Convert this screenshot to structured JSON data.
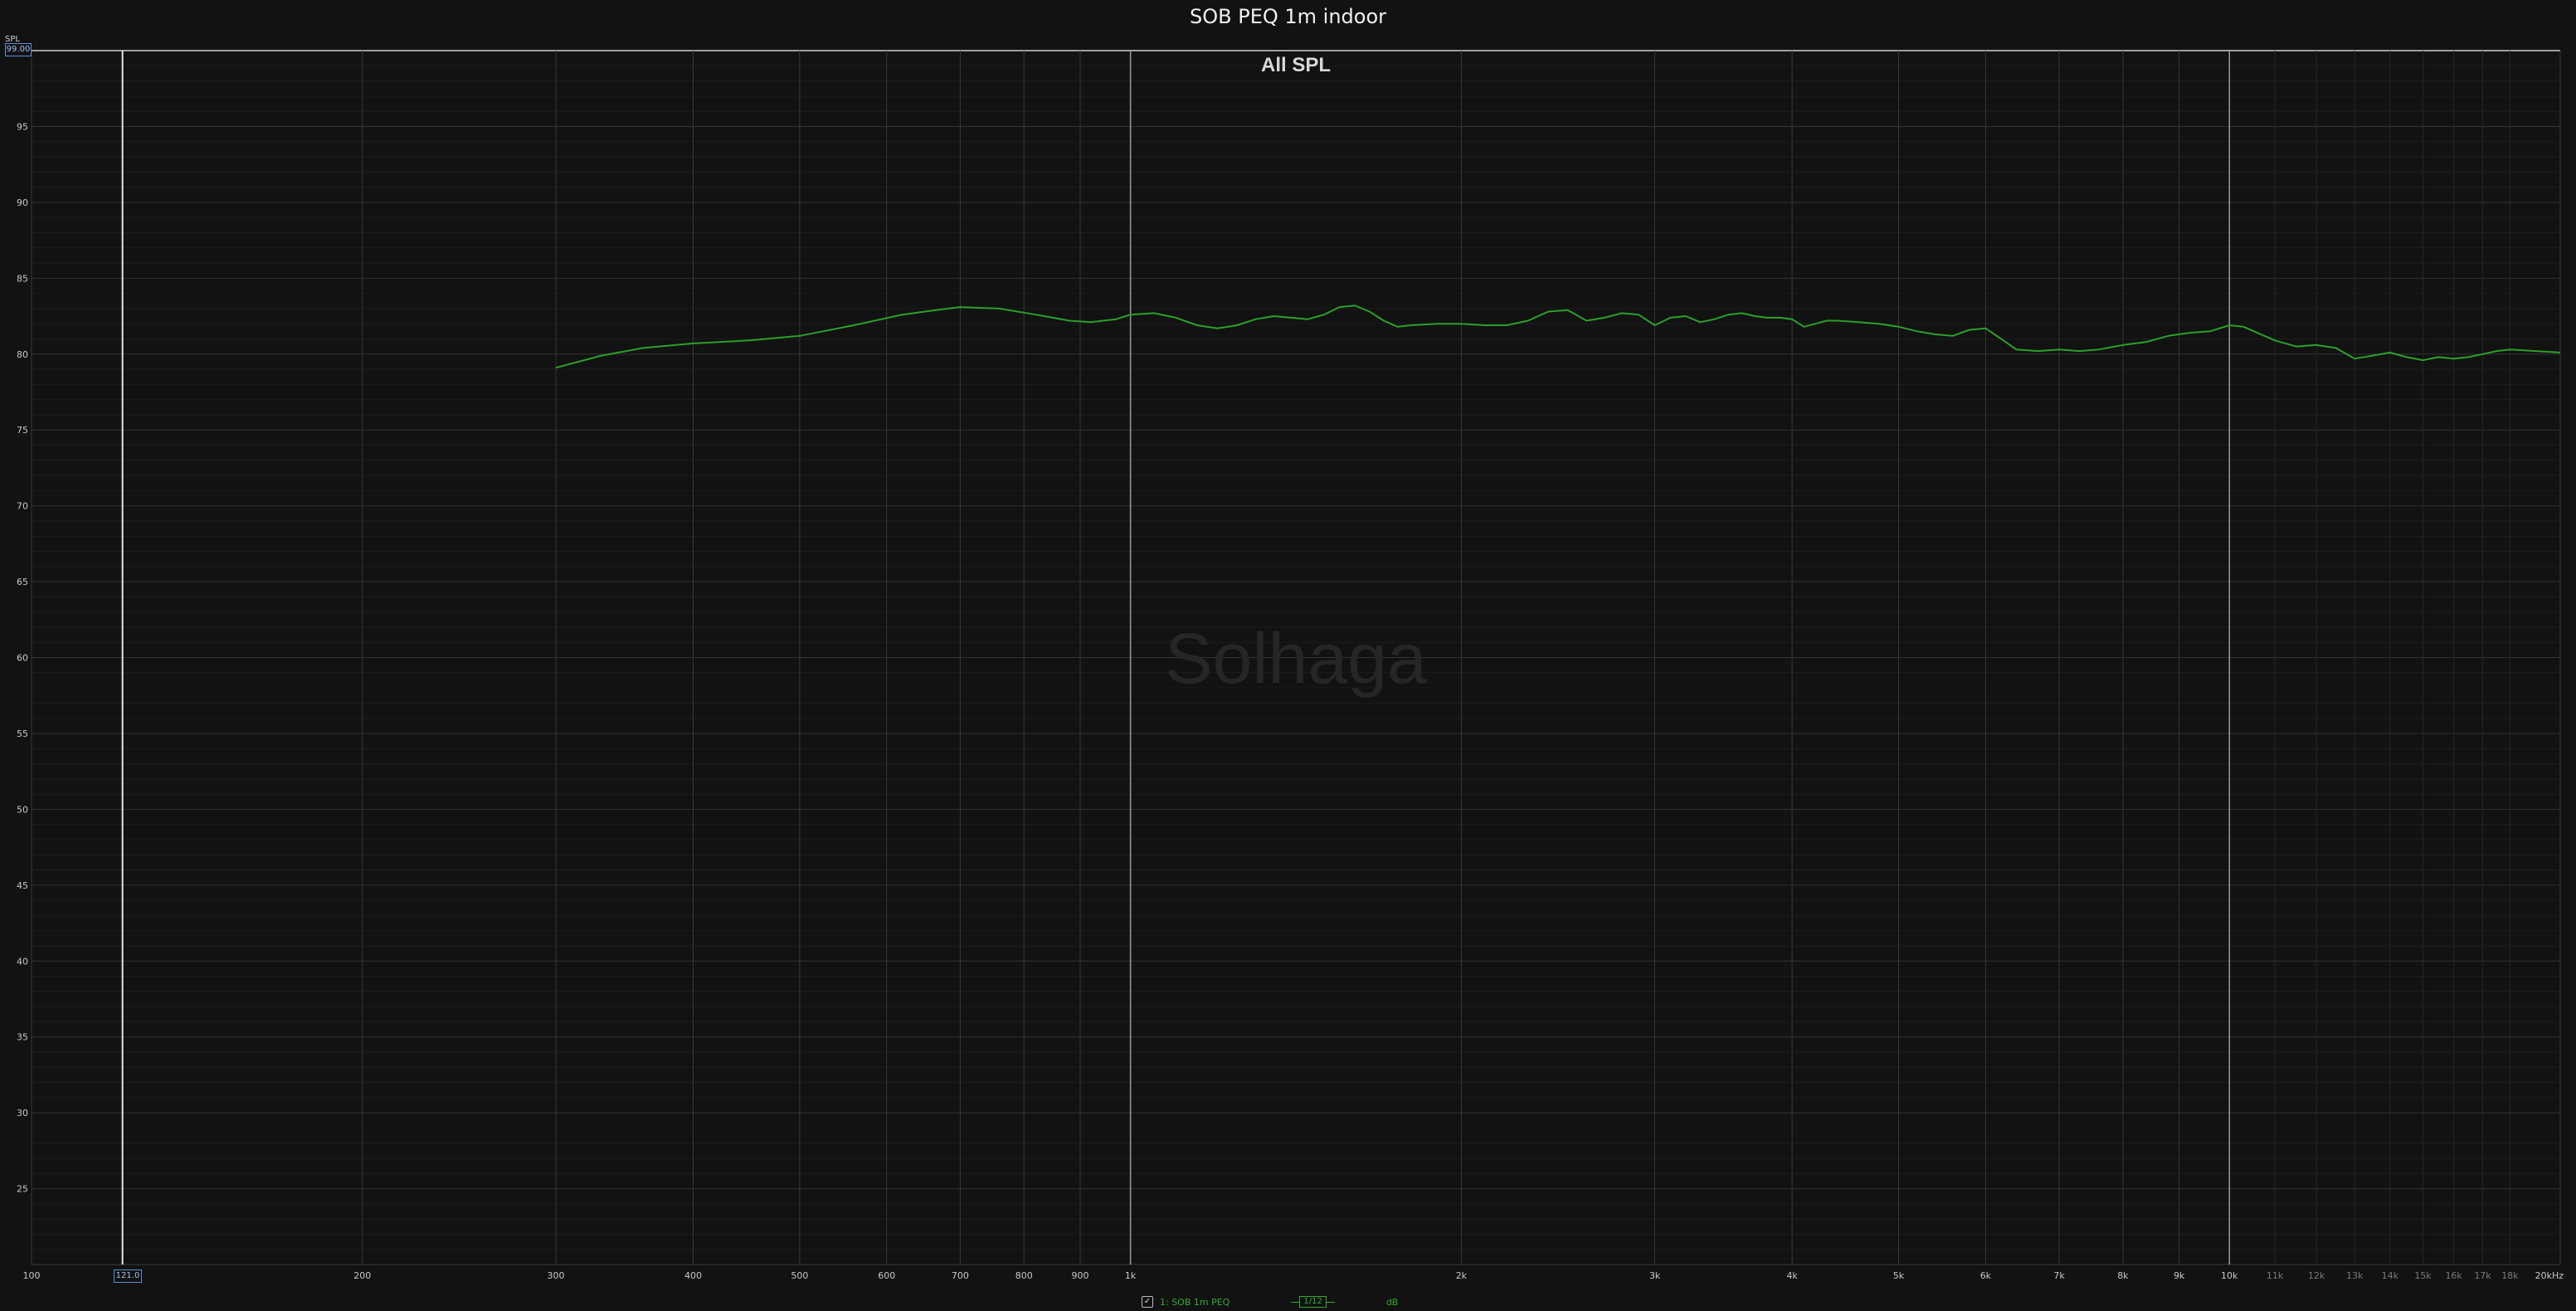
{
  "window": {
    "title": "SOB PEQ 1m indoor"
  },
  "chart_data": {
    "type": "line",
    "title": "SOB PEQ 1m indoor",
    "subtitle": "All SPL",
    "watermark": "Solhaga",
    "x_scale": "log",
    "xlim": [
      100,
      20000
    ],
    "ylim": [
      20,
      100
    ],
    "y_unit_label": "SPL",
    "y_readout": "99.00",
    "x_readout": "121.0",
    "x_ticks": [
      {
        "v": 100,
        "label": "100",
        "major": true
      },
      {
        "v": 200,
        "label": "200",
        "major": true
      },
      {
        "v": 300,
        "label": "300",
        "major": true
      },
      {
        "v": 400,
        "label": "400",
        "major": true
      },
      {
        "v": 500,
        "label": "500",
        "major": true
      },
      {
        "v": 600,
        "label": "600",
        "major": true
      },
      {
        "v": 700,
        "label": "700",
        "major": true
      },
      {
        "v": 800,
        "label": "800",
        "major": true
      },
      {
        "v": 900,
        "label": "900",
        "major": true
      },
      {
        "v": 1000,
        "label": "1k",
        "major": true
      },
      {
        "v": 2000,
        "label": "2k",
        "major": true
      },
      {
        "v": 3000,
        "label": "3k",
        "major": true
      },
      {
        "v": 4000,
        "label": "4k",
        "major": true
      },
      {
        "v": 5000,
        "label": "5k",
        "major": true
      },
      {
        "v": 6000,
        "label": "6k",
        "major": true
      },
      {
        "v": 7000,
        "label": "7k",
        "major": true
      },
      {
        "v": 8000,
        "label": "8k",
        "major": true
      },
      {
        "v": 9000,
        "label": "9k",
        "major": true
      },
      {
        "v": 10000,
        "label": "10k",
        "major": true
      },
      {
        "v": 11000,
        "label": "11k",
        "major": false
      },
      {
        "v": 12000,
        "label": "12k",
        "major": false
      },
      {
        "v": 13000,
        "label": "13k",
        "major": false
      },
      {
        "v": 14000,
        "label": "14k",
        "major": false
      },
      {
        "v": 15000,
        "label": "15k",
        "major": false
      },
      {
        "v": 16000,
        "label": "16k",
        "major": false
      },
      {
        "v": 17000,
        "label": "17k",
        "major": false
      },
      {
        "v": 18000,
        "label": "18k",
        "major": false
      },
      {
        "v": 20000,
        "label": "20kHz",
        "major": true
      }
    ],
    "y_ticks": [
      {
        "v": 95,
        "label": "95"
      },
      {
        "v": 90,
        "label": "90"
      },
      {
        "v": 85,
        "label": "85"
      },
      {
        "v": 80,
        "label": "80"
      },
      {
        "v": 75,
        "label": "75"
      },
      {
        "v": 70,
        "label": "70"
      },
      {
        "v": 65,
        "label": "65"
      },
      {
        "v": 60,
        "label": "60"
      },
      {
        "v": 55,
        "label": "55"
      },
      {
        "v": 50,
        "label": "50"
      },
      {
        "v": 45,
        "label": "45"
      },
      {
        "v": 40,
        "label": "40"
      },
      {
        "v": 35,
        "label": "35"
      },
      {
        "v": 30,
        "label": "30"
      },
      {
        "v": 25,
        "label": "25"
      }
    ],
    "cursor_lines_x": [
      121,
      1000,
      10000
    ],
    "series": [
      {
        "name": "1: SOB 1m PEQ",
        "color": "#2aa02a",
        "smoothing": "1/12",
        "unit": "dB",
        "x": [
          300,
          330,
          360,
          400,
          450,
          500,
          560,
          620,
          650,
          700,
          760,
          820,
          880,
          920,
          970,
          1000,
          1050,
          1100,
          1150,
          1200,
          1250,
          1300,
          1350,
          1400,
          1450,
          1500,
          1550,
          1600,
          1650,
          1700,
          1750,
          1800,
          1900,
          2000,
          2100,
          2200,
          2300,
          2400,
          2500,
          2600,
          2700,
          2800,
          2900,
          3000,
          3100,
          3200,
          3300,
          3400,
          3500,
          3600,
          3700,
          3800,
          3900,
          4000,
          4100,
          4200,
          4300,
          4400,
          4600,
          4800,
          5000,
          5200,
          5400,
          5600,
          5800,
          6000,
          6200,
          6400,
          6700,
          7000,
          7300,
          7600,
          8000,
          8400,
          8800,
          9200,
          9600,
          10000,
          10300,
          10600,
          11000,
          11500,
          12000,
          12500,
          13000,
          13500,
          14000,
          14500,
          15000,
          15500,
          16000,
          16500,
          17000,
          17500,
          18000,
          19000,
          20000
        ],
        "y": [
          79.1,
          79.9,
          80.4,
          80.7,
          80.9,
          81.2,
          81.9,
          82.6,
          82.8,
          83.1,
          83.0,
          82.6,
          82.2,
          82.1,
          82.3,
          82.6,
          82.7,
          82.4,
          81.9,
          81.7,
          81.9,
          82.3,
          82.5,
          82.4,
          82.3,
          82.6,
          83.1,
          83.2,
          82.8,
          82.2,
          81.8,
          81.9,
          82.0,
          82.0,
          81.9,
          81.9,
          82.2,
          82.8,
          82.9,
          82.2,
          82.4,
          82.7,
          82.6,
          81.9,
          82.4,
          82.5,
          82.1,
          82.3,
          82.6,
          82.7,
          82.5,
          82.4,
          82.4,
          82.3,
          81.8,
          82.0,
          82.2,
          82.2,
          82.1,
          82.0,
          81.8,
          81.5,
          81.3,
          81.2,
          81.6,
          81.7,
          81.0,
          80.3,
          80.2,
          80.3,
          80.2,
          80.3,
          80.6,
          80.8,
          81.2,
          81.4,
          81.5,
          81.9,
          81.8,
          81.4,
          80.9,
          80.5,
          80.6,
          80.4,
          79.7,
          79.9,
          80.1,
          79.8,
          79.6,
          79.8,
          79.7,
          79.8,
          80.0,
          80.2,
          80.3,
          80.2,
          80.1
        ]
      }
    ]
  }
}
